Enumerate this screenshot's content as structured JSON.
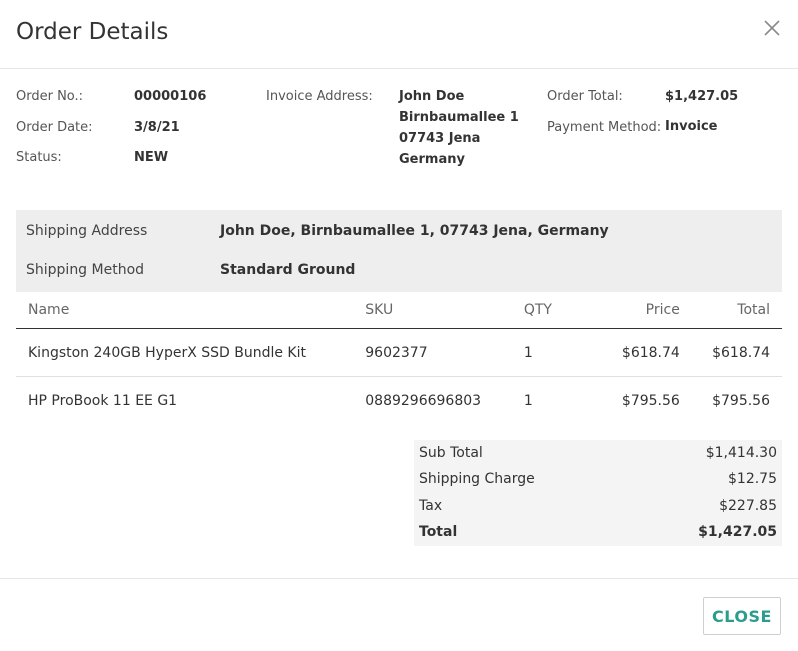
{
  "dialog": {
    "title": "Order Details",
    "close_icon": "close-icon"
  },
  "order": {
    "number_label": "Order No.:",
    "number": "00000106",
    "date_label": "Order Date:",
    "date": "3/8/21",
    "status_label": "Status:",
    "status": "NEW",
    "invoice_address_label": "Invoice Address:",
    "invoice_address": [
      "John Doe",
      "Birnbaumallee 1",
      "07743 Jena",
      "Germany"
    ],
    "total_label": "Order Total:",
    "total": "$1,427.05",
    "payment_method_label": "Payment Method:",
    "payment_method": "Invoice"
  },
  "shipping": {
    "address_label": "Shipping Address",
    "address": "John Doe, Birnbaumallee 1, 07743 Jena, Germany",
    "method_label": "Shipping Method",
    "method": "Standard Ground"
  },
  "items": {
    "columns": [
      "Name",
      "SKU",
      "QTY",
      "Price",
      "Total"
    ],
    "rows": [
      {
        "name": "Kingston 240GB HyperX SSD Bundle Kit",
        "sku": "9602377",
        "qty": "1",
        "price": "$618.74",
        "total": "$618.74"
      },
      {
        "name": "HP ProBook 11 EE G1",
        "sku": "0889296696803",
        "qty": "1",
        "price": "$795.56",
        "total": "$795.56"
      }
    ]
  },
  "summary": {
    "subtotal_label": "Sub Total",
    "subtotal": "$1,414.30",
    "shipping_label": "Shipping Charge",
    "shipping": "$12.75",
    "tax_label": "Tax",
    "tax": "$227.85",
    "total_label": "Total",
    "total": "$1,427.05"
  },
  "footer": {
    "close_label": "CLOSE"
  },
  "colors": {
    "accent": "#2a9d8f",
    "shipping_bg": "#eeeeee",
    "summary_bg": "#f4f4f4"
  }
}
